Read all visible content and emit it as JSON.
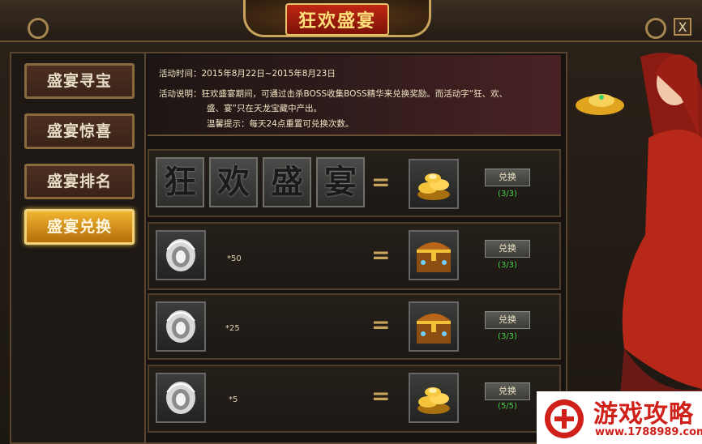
{
  "window": {
    "title": "狂欢盛宴",
    "close_label": "X"
  },
  "tabs": [
    {
      "label": "盛宴寻宝",
      "active": false
    },
    {
      "label": "盛宴惊喜",
      "active": false
    },
    {
      "label": "盛宴排名",
      "active": false
    },
    {
      "label": "盛宴兑换",
      "active": true
    }
  ],
  "info": {
    "time_line": "活动时间：2015年8月22日~2015年8月23日",
    "desc_line1": "活动说明：狂欢盛宴期间，可通过击杀BOSS收集BOSS精华来兑换奖励。而活动字“狂、欢、",
    "desc_line2": "盛、宴”只在天龙宝藏中产出。",
    "tip_line": "温馨提示：每天24点重置可兑换次数。"
  },
  "exchanges": [
    {
      "chars": [
        "狂",
        "欢",
        "盛",
        "宴"
      ],
      "quantity": "",
      "reward_icon": "gold-ingots-icon",
      "button_label": "兑换",
      "count": "(3/3)"
    },
    {
      "chars": [],
      "item_icon": "boss-essence-icon",
      "quantity": "*50",
      "reward_icon": "treasure-chest-icon",
      "button_label": "兑换",
      "count": "(3/3)"
    },
    {
      "chars": [],
      "item_icon": "boss-essence-icon",
      "quantity": "*25",
      "reward_icon": "treasure-chest-icon",
      "button_label": "兑换",
      "count": "(3/3)"
    },
    {
      "chars": [],
      "item_icon": "boss-essence-icon",
      "quantity": "*5",
      "reward_icon": "gold-ingots-icon",
      "button_label": "兑换",
      "count": "(5/5)"
    }
  ],
  "equals_sign": "=",
  "watermark": {
    "title": "游戏攻略",
    "url": "www.1788989.com"
  },
  "colors": {
    "active_tab": "#f0b431",
    "count_green": "#47d147",
    "title_red": "#c02814"
  }
}
